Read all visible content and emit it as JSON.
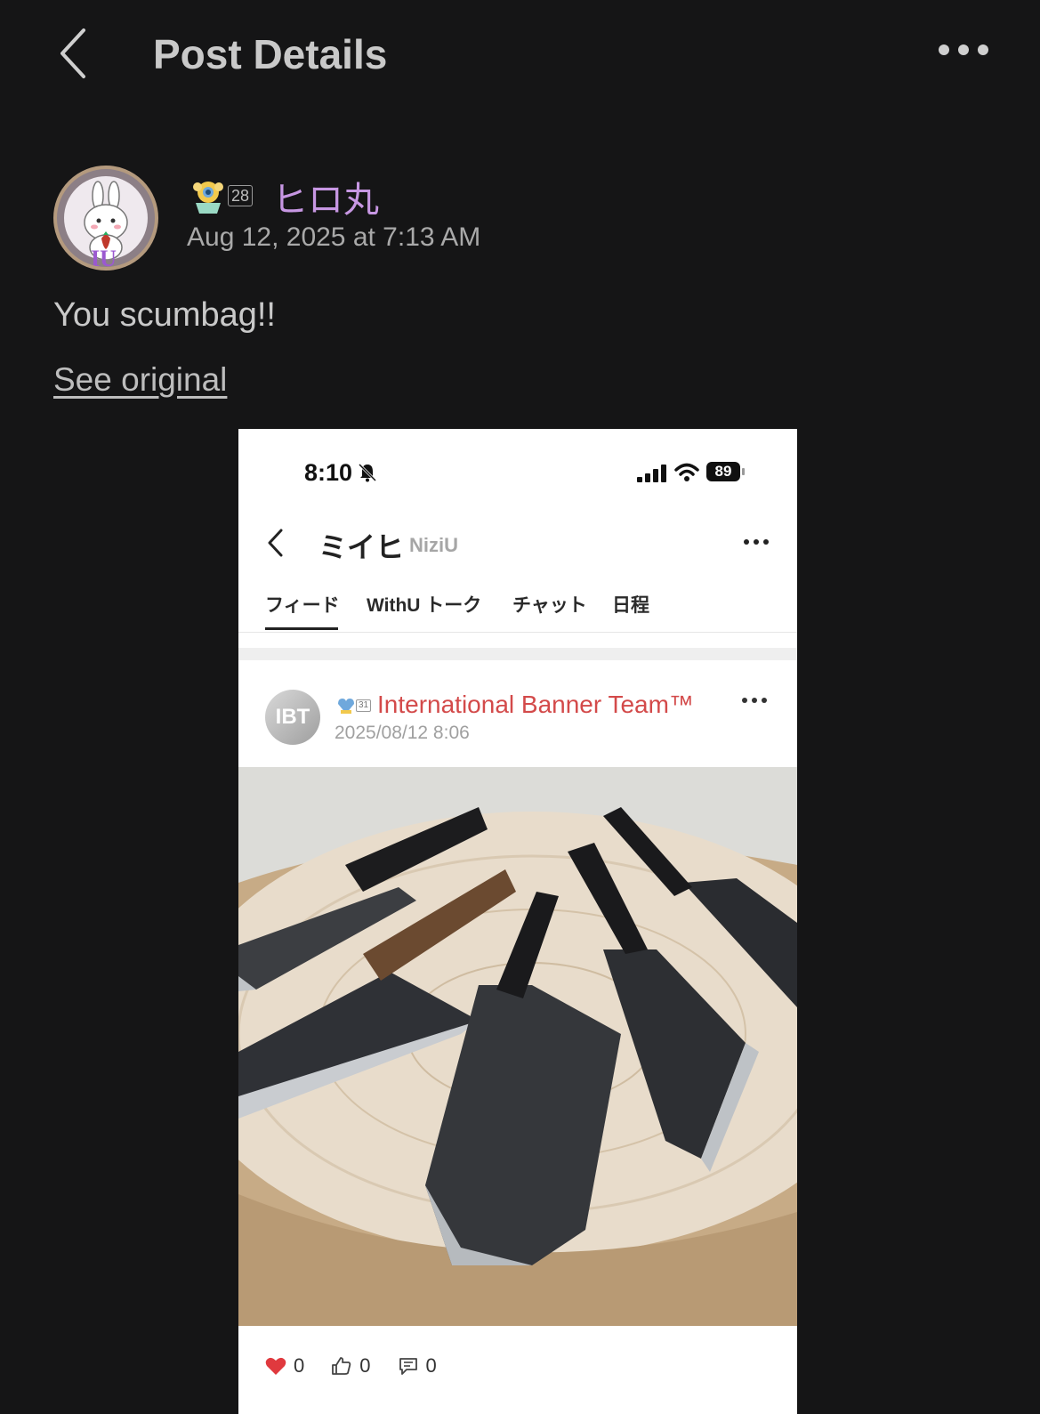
{
  "header": {
    "title": "Post Details"
  },
  "post": {
    "author": {
      "name": "ヒロ丸",
      "level": "28",
      "avatar_text": "IU"
    },
    "date": "Aug 12, 2025 at 7:13 AM",
    "text": "You scumbag!!",
    "see_original": "See original"
  },
  "screenshot": {
    "status_time": "8:10",
    "battery": "89",
    "community": "ミイヒ",
    "group": "NiziU",
    "tabs": [
      "フィード",
      "WithU トーク",
      "チャット",
      "日程"
    ],
    "inner_post": {
      "avatar_text": "IBT",
      "level": "31",
      "author": "International Banner Team™",
      "date": "2025/08/12 8:06",
      "reactions": {
        "hearts": "0",
        "likes": "0",
        "comments": "0"
      }
    }
  },
  "colors": {
    "background": "#151516",
    "username": "#c797e3",
    "inner_author": "#d34a4a"
  }
}
